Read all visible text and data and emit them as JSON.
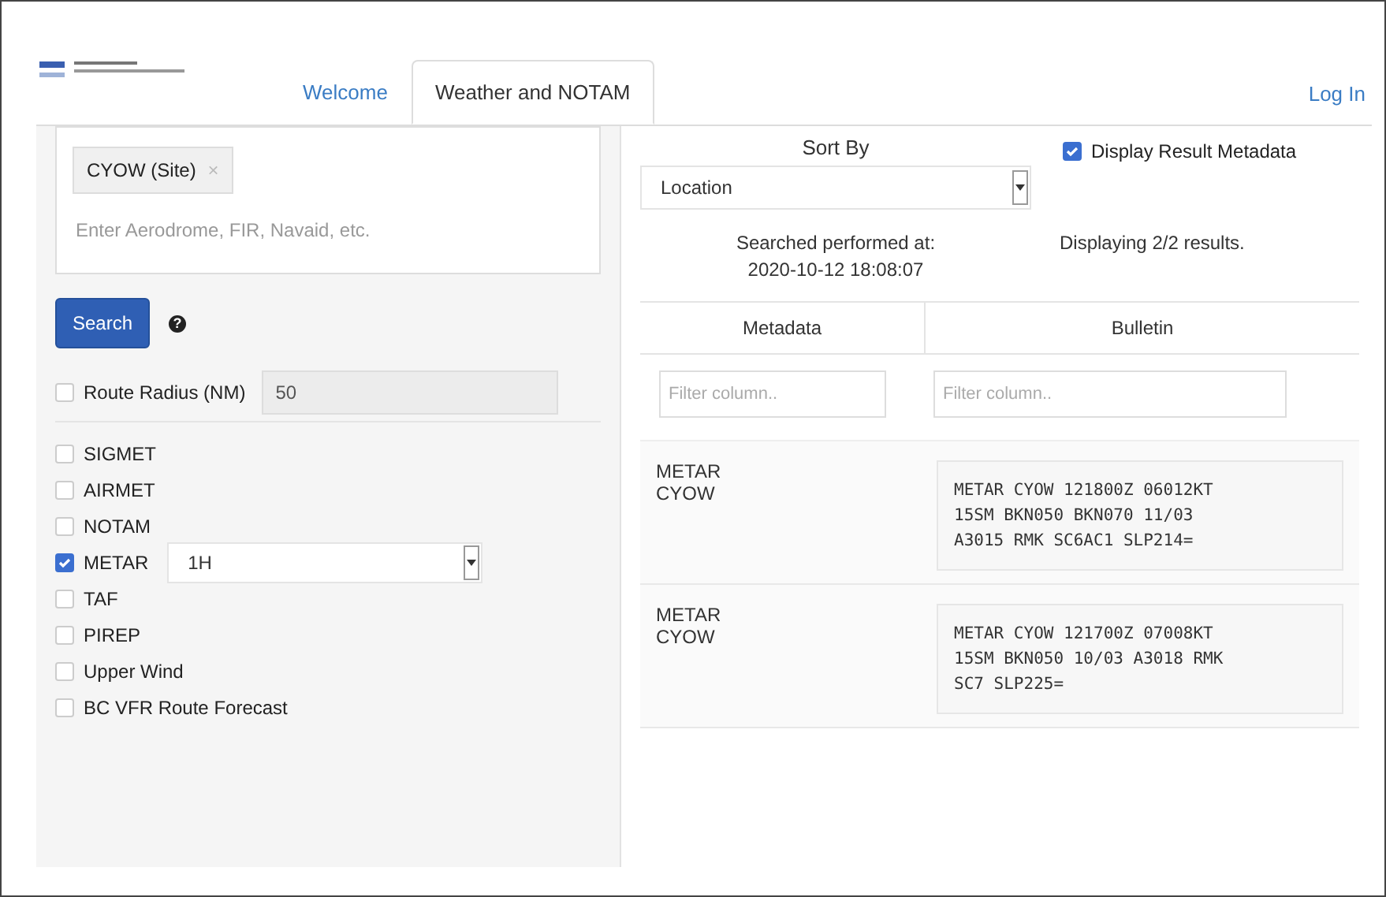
{
  "tabs": [
    {
      "label": "Welcome",
      "selected": false
    },
    {
      "label": "Weather and NOTAM",
      "selected": true
    }
  ],
  "login": "Log In",
  "search": {
    "chip": "CYOW (Site)",
    "chip_remove": "×",
    "placeholder": "Enter Aerodrome, FIR, Navaid, etc.",
    "button": "Search",
    "help": "?"
  },
  "route_radius": {
    "label": "Route Radius (NM)",
    "checked": false,
    "value": "50"
  },
  "products": [
    {
      "label": "SIGMET",
      "checked": false
    },
    {
      "label": "AIRMET",
      "checked": false
    },
    {
      "label": "NOTAM",
      "checked": false
    },
    {
      "label": "METAR",
      "checked": true,
      "option": "1H"
    },
    {
      "label": "TAF",
      "checked": false
    },
    {
      "label": "PIREP",
      "checked": false
    },
    {
      "label": "Upper Wind",
      "checked": false
    },
    {
      "label": "BC VFR Route Forecast",
      "checked": false
    }
  ],
  "sort": {
    "label": "Sort By",
    "value": "Location"
  },
  "metadata_toggle": {
    "label": "Display Result Metadata",
    "checked": true
  },
  "searched_at": [
    "Searched performed at:",
    "2020-10-12 18:08:07"
  ],
  "result_count": "Displaying 2/2 results.",
  "columns": [
    {
      "title": "Metadata",
      "filter_placeholder": "Filter column.."
    },
    {
      "title": "Bulletin",
      "filter_placeholder": "Filter column.."
    }
  ],
  "results": [
    {
      "metadata": [
        "METAR",
        "CYOW"
      ],
      "bulletin": [
        "METAR CYOW 121800Z 06012KT",
        "15SM BKN050 BKN070 11/03",
        "A3015 RMK SC6AC1 SLP214="
      ]
    },
    {
      "metadata": [
        "METAR",
        "CYOW"
      ],
      "bulletin": [
        "METAR CYOW 121700Z 07008KT",
        "15SM BKN050 10/03 A3018 RMK",
        "SC7 SLP225="
      ]
    }
  ]
}
